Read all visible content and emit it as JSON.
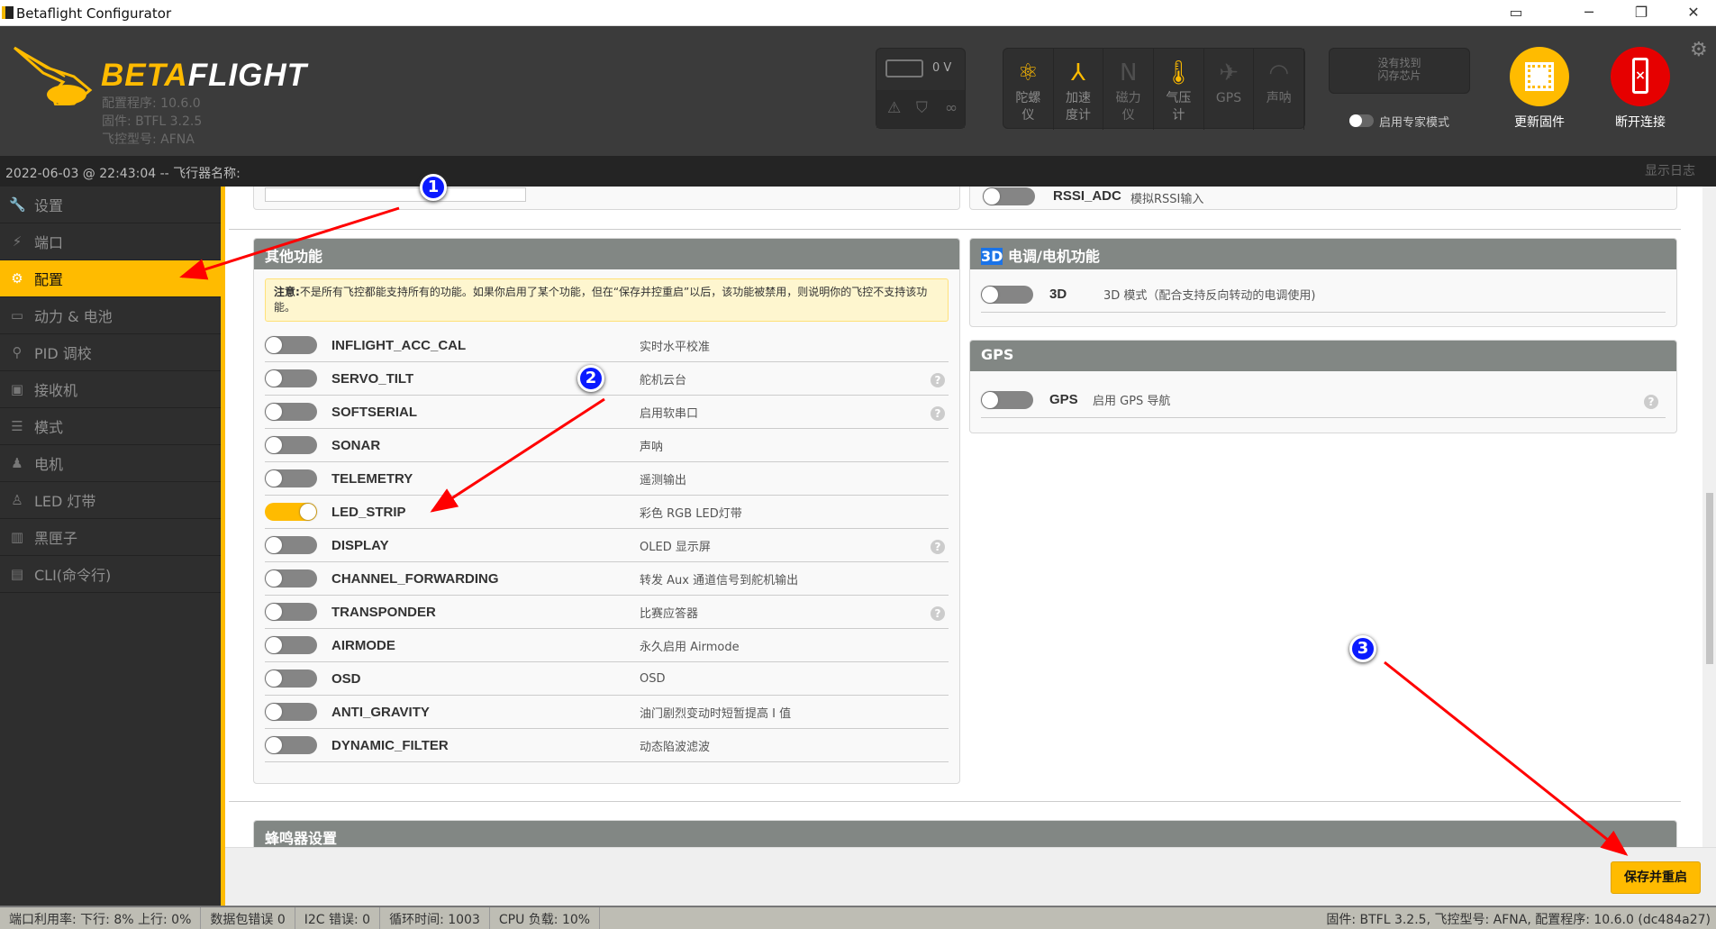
{
  "window": {
    "title": "Betaflight Configurator",
    "controls": [
      "minimize",
      "restore",
      "close"
    ]
  },
  "header": {
    "logo": {
      "beta": "BETA",
      "flight": "FLIGHT"
    },
    "configurator_version": "配置程序: 10.6.0",
    "firmware": "固件: BTFL 3.2.5",
    "board": "飞控型号: AFNA",
    "battery_voltage": "0 V",
    "sensors": [
      {
        "label": "陀螺仪",
        "icon": "gyro-icon",
        "active": true
      },
      {
        "label": "加速度计",
        "icon": "accel-icon",
        "active": true
      },
      {
        "label": "磁力仪",
        "icon": "compass-icon",
        "active": false
      },
      {
        "label": "气压计",
        "icon": "barometer-icon",
        "active": true
      },
      {
        "label": "GPS",
        "icon": "gps-icon",
        "active": false
      },
      {
        "label": "声呐",
        "icon": "sonar-icon",
        "active": false
      }
    ],
    "flash_status": "没有找到闪存芯片",
    "expert_mode_label": "启用专家模式",
    "expert_mode": false,
    "update_firmware": "更新固件",
    "disconnect": "断开连接"
  },
  "logbar": {
    "text": "2022-06-03 @ 22:43:04 -- 飞行器名称:",
    "show_log": "显示日志"
  },
  "sidebar": {
    "items": [
      {
        "label": "设置",
        "icon": "wrench-icon"
      },
      {
        "label": "端口",
        "icon": "plug-icon"
      },
      {
        "label": "配置",
        "icon": "gear-icon",
        "active": true
      },
      {
        "label": "动力 & 电池",
        "icon": "battery-icon"
      },
      {
        "label": "PID 调校",
        "icon": "hierarchy-icon"
      },
      {
        "label": "接收机",
        "icon": "receiver-icon"
      },
      {
        "label": "模式",
        "icon": "switches-icon"
      },
      {
        "label": "电机",
        "icon": "motor-icon"
      },
      {
        "label": "LED 灯带",
        "icon": "led-icon"
      },
      {
        "label": "黑匣子",
        "icon": "chip-icon"
      },
      {
        "label": "CLI(命令行)",
        "icon": "terminal-icon"
      }
    ]
  },
  "other_features": {
    "title": "其他功能",
    "note_bold": "注意:",
    "note": "不是所有飞控都能支持所有的功能。如果你启用了某个功能，但在“保存并控重启”以后，该功能被禁用，则说明你的飞控不支持该功能。",
    "features": [
      {
        "name": "INFLIGHT_ACC_CAL",
        "desc": "实时水平校准",
        "enabled": false,
        "help": false
      },
      {
        "name": "SERVO_TILT",
        "desc": "舵机云台",
        "enabled": false,
        "help": true
      },
      {
        "name": "SOFTSERIAL",
        "desc": "启用软串口",
        "enabled": false,
        "help": true
      },
      {
        "name": "SONAR",
        "desc": "声呐",
        "enabled": false,
        "help": false
      },
      {
        "name": "TELEMETRY",
        "desc": "遥测输出",
        "enabled": false,
        "help": false
      },
      {
        "name": "LED_STRIP",
        "desc": "彩色 RGB LED灯带",
        "enabled": true,
        "help": false
      },
      {
        "name": "DISPLAY",
        "desc": "OLED 显示屏",
        "enabled": false,
        "help": true
      },
      {
        "name": "CHANNEL_FORWARDING",
        "desc": "转发 Aux 通道信号到舵机输出",
        "enabled": false,
        "help": false
      },
      {
        "name": "TRANSPONDER",
        "desc": "比赛应答器",
        "enabled": false,
        "help": true
      },
      {
        "name": "AIRMODE",
        "desc": "永久启用 Airmode",
        "enabled": false,
        "help": false
      },
      {
        "name": "OSD",
        "desc": "OSD",
        "enabled": false,
        "help": false
      },
      {
        "name": "ANTI_GRAVITY",
        "desc": "油门剧烈变动时短暂提高 I 值",
        "enabled": false,
        "help": false
      },
      {
        "name": "DYNAMIC_FILTER",
        "desc": "动态陷波滤波",
        "enabled": false,
        "help": false
      }
    ]
  },
  "partial_top": {
    "rssi_name": "RSSI_ADC",
    "rssi_desc": "模拟RSSI输入"
  },
  "esc_panel": {
    "title_hl": "3D",
    "title": "电调/电机功能",
    "feature": {
      "name": "3D",
      "desc": "3D 模式（配合支持反向转动的电调使用)",
      "enabled": false
    }
  },
  "gps_panel": {
    "title": "GPS",
    "feature": {
      "name": "GPS",
      "desc": "启用 GPS 导航",
      "enabled": false,
      "help": true
    }
  },
  "buzzer_panel": {
    "title": "蜂鸣器设置"
  },
  "save_button": "保存并重启",
  "annotations": [
    "1",
    "2",
    "3"
  ],
  "status": {
    "port_util": "端口利用率:  下行: 8% 上行: 0%",
    "packet_error": "数据包错误 0",
    "i2c_error": "I2C 错误: 0",
    "cycle_time": "循环时间: 1003",
    "cpu_load": "CPU 负载: 10%",
    "version_info": "固件: BTFL 3.2.5, 飞控型号: AFNA, 配置程序: 10.6.0 (dc484a27)"
  },
  "colors": {
    "accent": "#ffbb00",
    "disconnect": "#e60000",
    "marker": "#0a1aff",
    "arrow": "#ff0000"
  }
}
